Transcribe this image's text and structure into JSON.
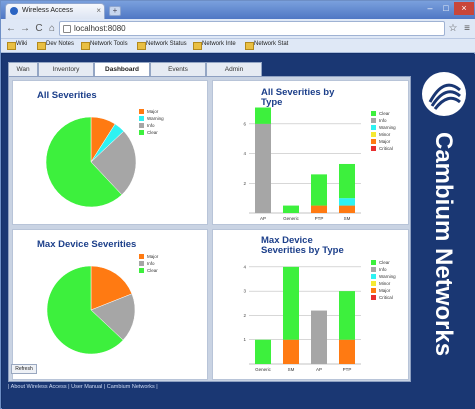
{
  "browser": {
    "tab_title": "Wireless Access",
    "tab_close": "×",
    "new_tab": "+",
    "window_controls": [
      "–",
      "□",
      "×"
    ],
    "nav": {
      "back": "←",
      "forward": "→",
      "reload": "C",
      "home": "⌂",
      "star": "☆",
      "tools": "≡"
    },
    "url": "localhost:8080",
    "bookmarks": [
      "Wiki",
      "Dev Notes",
      "Network Tools",
      "Network Status",
      "Network Inte",
      "Network Stat"
    ]
  },
  "app": {
    "tabs": [
      "Wan",
      "Inventory",
      "Dashboard",
      "Events",
      "Admin"
    ],
    "active_tab": 2,
    "refresh_label": "Refresh",
    "footer_links": [
      "About Wireless Access",
      "User Manual",
      "Cambium Networks"
    ],
    "brand": "Cambium Networks"
  },
  "panels": {
    "p1": {
      "title": "All Severities"
    },
    "p2": {
      "title": "All Severities by",
      "title2": "Type"
    },
    "p3": {
      "title": "Max Device Severities"
    },
    "p4": {
      "title": "Max Device",
      "title2": "Severities by Type"
    }
  },
  "colors": {
    "clear": "#3df03d",
    "info": "#a6a6a6",
    "warning": "#2ef2f2",
    "minor": "#f5e933",
    "major": "#ff7a12",
    "critical": "#e82f2f",
    "title": "#1c3f8a"
  },
  "chart_data": [
    {
      "type": "pie",
      "title": "All Severities",
      "legend": [
        "Major",
        "Warning",
        "Info",
        "Clear"
      ],
      "values": [
        9,
        4,
        25,
        62
      ]
    },
    {
      "type": "bar",
      "stacked": true,
      "title": "All Severities by Type",
      "categories": [
        "AP",
        "Generic",
        "PTP",
        "SM"
      ],
      "legend": [
        "Clear",
        "Info",
        "Warning",
        "Minor",
        "Major",
        "Critical"
      ],
      "yticks": [
        "6",
        "4",
        "2"
      ],
      "series": [
        {
          "name": "Info",
          "values": [
            6,
            0,
            0,
            0
          ]
        },
        {
          "name": "Major",
          "values": [
            0,
            0,
            0.5,
            0.5
          ]
        },
        {
          "name": "Warning",
          "values": [
            0,
            0,
            0,
            0.5
          ]
        },
        {
          "name": "Clear",
          "values": [
            1.1,
            0.5,
            2.1,
            2.3
          ]
        }
      ],
      "ylim": [
        0,
        7
      ]
    },
    {
      "type": "pie",
      "title": "Max Device Severities",
      "legend": [
        "Major",
        "Info",
        "Clear"
      ],
      "values": [
        19,
        18,
        63
      ]
    },
    {
      "type": "bar",
      "stacked": true,
      "title": "Max Device Severities by Type",
      "categories": [
        "Generic",
        "SM",
        "AP",
        "PTP"
      ],
      "legend": [
        "Clear",
        "Info",
        "Warning",
        "Minor",
        "Major",
        "Critical"
      ],
      "yticks": [
        "4",
        "3",
        "2",
        "1"
      ],
      "series": [
        {
          "name": "Info",
          "values": [
            0,
            0,
            2.2,
            0
          ]
        },
        {
          "name": "Major",
          "values": [
            0,
            1,
            0,
            1
          ]
        },
        {
          "name": "Clear",
          "values": [
            1,
            3,
            0,
            2
          ]
        }
      ],
      "ylim": [
        0,
        4.2
      ]
    }
  ]
}
